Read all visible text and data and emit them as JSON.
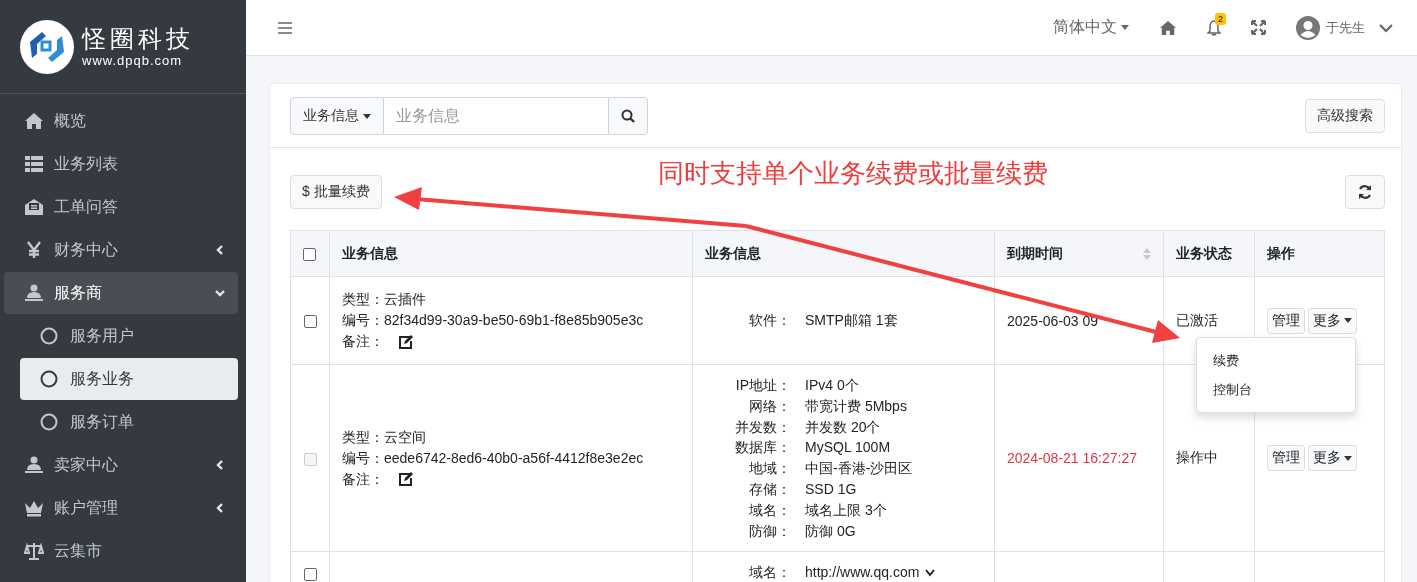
{
  "logo": {
    "name": "怪圈科技",
    "url": "www.dpqb.com"
  },
  "sidebar": {
    "items": [
      {
        "label": "概览",
        "kind": "link",
        "selected": false
      },
      {
        "label": "业务列表",
        "kind": "link",
        "selected": false
      },
      {
        "label": "工单问答",
        "kind": "link",
        "selected": false
      },
      {
        "label": "财务中心",
        "kind": "group",
        "expanded": false,
        "selected": false
      },
      {
        "label": "服务商",
        "kind": "group",
        "expanded": true,
        "selected": true,
        "children": [
          {
            "label": "服务用户",
            "selected": false
          },
          {
            "label": "服务业务",
            "selected": true
          },
          {
            "label": "服务订单",
            "selected": false
          }
        ]
      },
      {
        "label": "卖家中心",
        "kind": "group",
        "expanded": false,
        "selected": false
      },
      {
        "label": "账户管理",
        "kind": "group",
        "expanded": false,
        "selected": false
      },
      {
        "label": "云集市",
        "kind": "link",
        "selected": false
      }
    ]
  },
  "header": {
    "language": "简体中文",
    "notifications": "2",
    "user": "于先生"
  },
  "search": {
    "scope": "业务信息",
    "placeholder": "业务信息",
    "advanced": "高级搜索"
  },
  "batch_button": "$ 批量续费",
  "annotation": "同时支持单个业务续费或批量续费",
  "table": {
    "select_all": {
      "checked": false
    },
    "columns": [
      {
        "label": "业务信息",
        "sortable": false
      },
      {
        "label": "业务信息",
        "sortable": false
      },
      {
        "label": "到期时间",
        "sortable": true
      },
      {
        "label": "业务状态",
        "sortable": false
      },
      {
        "label": "操作",
        "sortable": false
      }
    ],
    "rows": [
      {
        "checked": false,
        "disabled": false,
        "type_label": "类型：",
        "type": "云插件",
        "id_label": "编号：",
        "id": "82f34d99-30a9-be50-69b1-f8e85b905e3c",
        "note_label": "备注：",
        "specs": [
          {
            "label": "软件：",
            "value": "SMTP邮箱 1套"
          }
        ],
        "expiry": "2025-06-03 09",
        "expired": false,
        "status": "已激活",
        "manage": "管理",
        "more": "更多"
      },
      {
        "checked": false,
        "disabled": true,
        "type_label": "类型：",
        "type": "云空间",
        "id_label": "编号：",
        "id": "eede6742-8ed6-40b0-a56f-4412f8e3e2ec",
        "note_label": "备注：",
        "specs": [
          {
            "label": "IP地址：",
            "value": "IPv4 0个"
          },
          {
            "label": "网络：",
            "value": "带宽计费 5Mbps"
          },
          {
            "label": "并发数：",
            "value": "并发数 20个"
          },
          {
            "label": "数据库：",
            "value": "MySQL 100M"
          },
          {
            "label": "地域：",
            "value": "中国-香港-沙田区"
          },
          {
            "label": "存储：",
            "value": "SSD 1G"
          },
          {
            "label": "域名：",
            "value": "域名上限 3个"
          },
          {
            "label": "防御：",
            "value": "防御 0G"
          }
        ],
        "expiry": "2024-08-21 16:27:27",
        "expired": true,
        "status": "操作中",
        "manage": "管理",
        "more": "更多"
      },
      {
        "checked": false,
        "disabled": false,
        "specs": [
          {
            "label": "域名：",
            "value": "http://www.qq.com",
            "dropdown": true
          }
        ]
      }
    ]
  },
  "menu": {
    "items": [
      "续费",
      "控制台"
    ]
  }
}
